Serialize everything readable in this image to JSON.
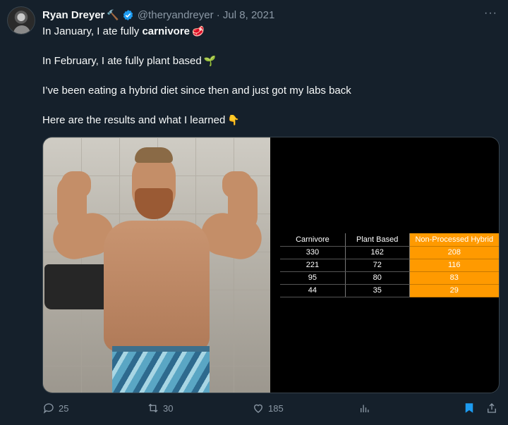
{
  "author": {
    "name": "Ryan Dreyer",
    "name_emoji": "🔨",
    "handle_date": "@theryandreyer · Jul 8, 2021"
  },
  "more_glyph": "···",
  "tweet": {
    "line1_prefix": "In January, I ate fully ",
    "line1_bold": "carnivore",
    "line1_emoji": "🥩",
    "line2": "In February, I ate fully plant based",
    "line2_emoji": "🌱",
    "line3": "I’ve been eating a hybrid diet since then and just got my labs back",
    "line4": "Here are the results and what I learned",
    "line4_emoji": "👇"
  },
  "table": {
    "headers": [
      "Carnivore",
      "Plant Based",
      "Non-Processed Hybrid"
    ],
    "rows": [
      [
        "330",
        "162",
        "208"
      ],
      [
        "221",
        "72",
        "116"
      ],
      [
        "95",
        "80",
        "83"
      ],
      [
        "44",
        "35",
        "29"
      ]
    ],
    "highlight_color": "#ff9a00"
  },
  "actions": {
    "replies": "25",
    "retweets": "30",
    "likes": "185"
  },
  "colors": {
    "background": "#15202b",
    "text": "#f7f9f9",
    "muted": "#8b98a5",
    "accent": "#1d9bf0"
  },
  "icons": [
    "verified-badge-icon",
    "reply-icon",
    "retweet-icon",
    "like-icon",
    "views-icon",
    "bookmark-icon",
    "share-icon"
  ]
}
